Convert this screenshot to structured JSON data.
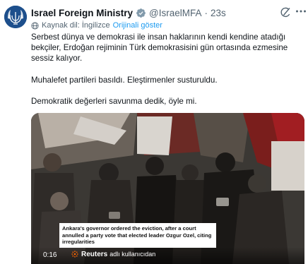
{
  "tweet": {
    "author_name": "Israel Foreign Ministry",
    "handle": "@IsraelMFA",
    "separator": "·",
    "timestamp": "23s",
    "avatar_icon": "israel-emblem-menorah",
    "verified_badge_color": "#829aab",
    "translation": {
      "label": "Kaynak dil: İngilizce",
      "show_original": "Orijinali göster"
    },
    "paragraphs": [
      "Serbest dünya ve demokrasi ile insan haklarının kendi kendine atadığı bekçiler, Erdoğan rejiminin Türk demokrasisini gün ortasında ezmesine sessiz kalıyor.",
      "Muhalefet partileri basıldı. Eleştirmenler susturuldu.",
      "Demokratik değerleri savunma dedik, öyle mi."
    ],
    "media": {
      "caption": "Ankara's governor ordered the eviction, after a court annulled a party vote that elected leader Ozgur Ozel, citing irregularities",
      "timecode": "0:16",
      "source_name": "Reuters",
      "source_suffix": "adlı kullanıcıdan"
    }
  },
  "colors": {
    "text_primary": "#0f1419",
    "text_secondary": "#536471",
    "link": "#1d9bf0",
    "reuters_orange": "#fa6400"
  }
}
